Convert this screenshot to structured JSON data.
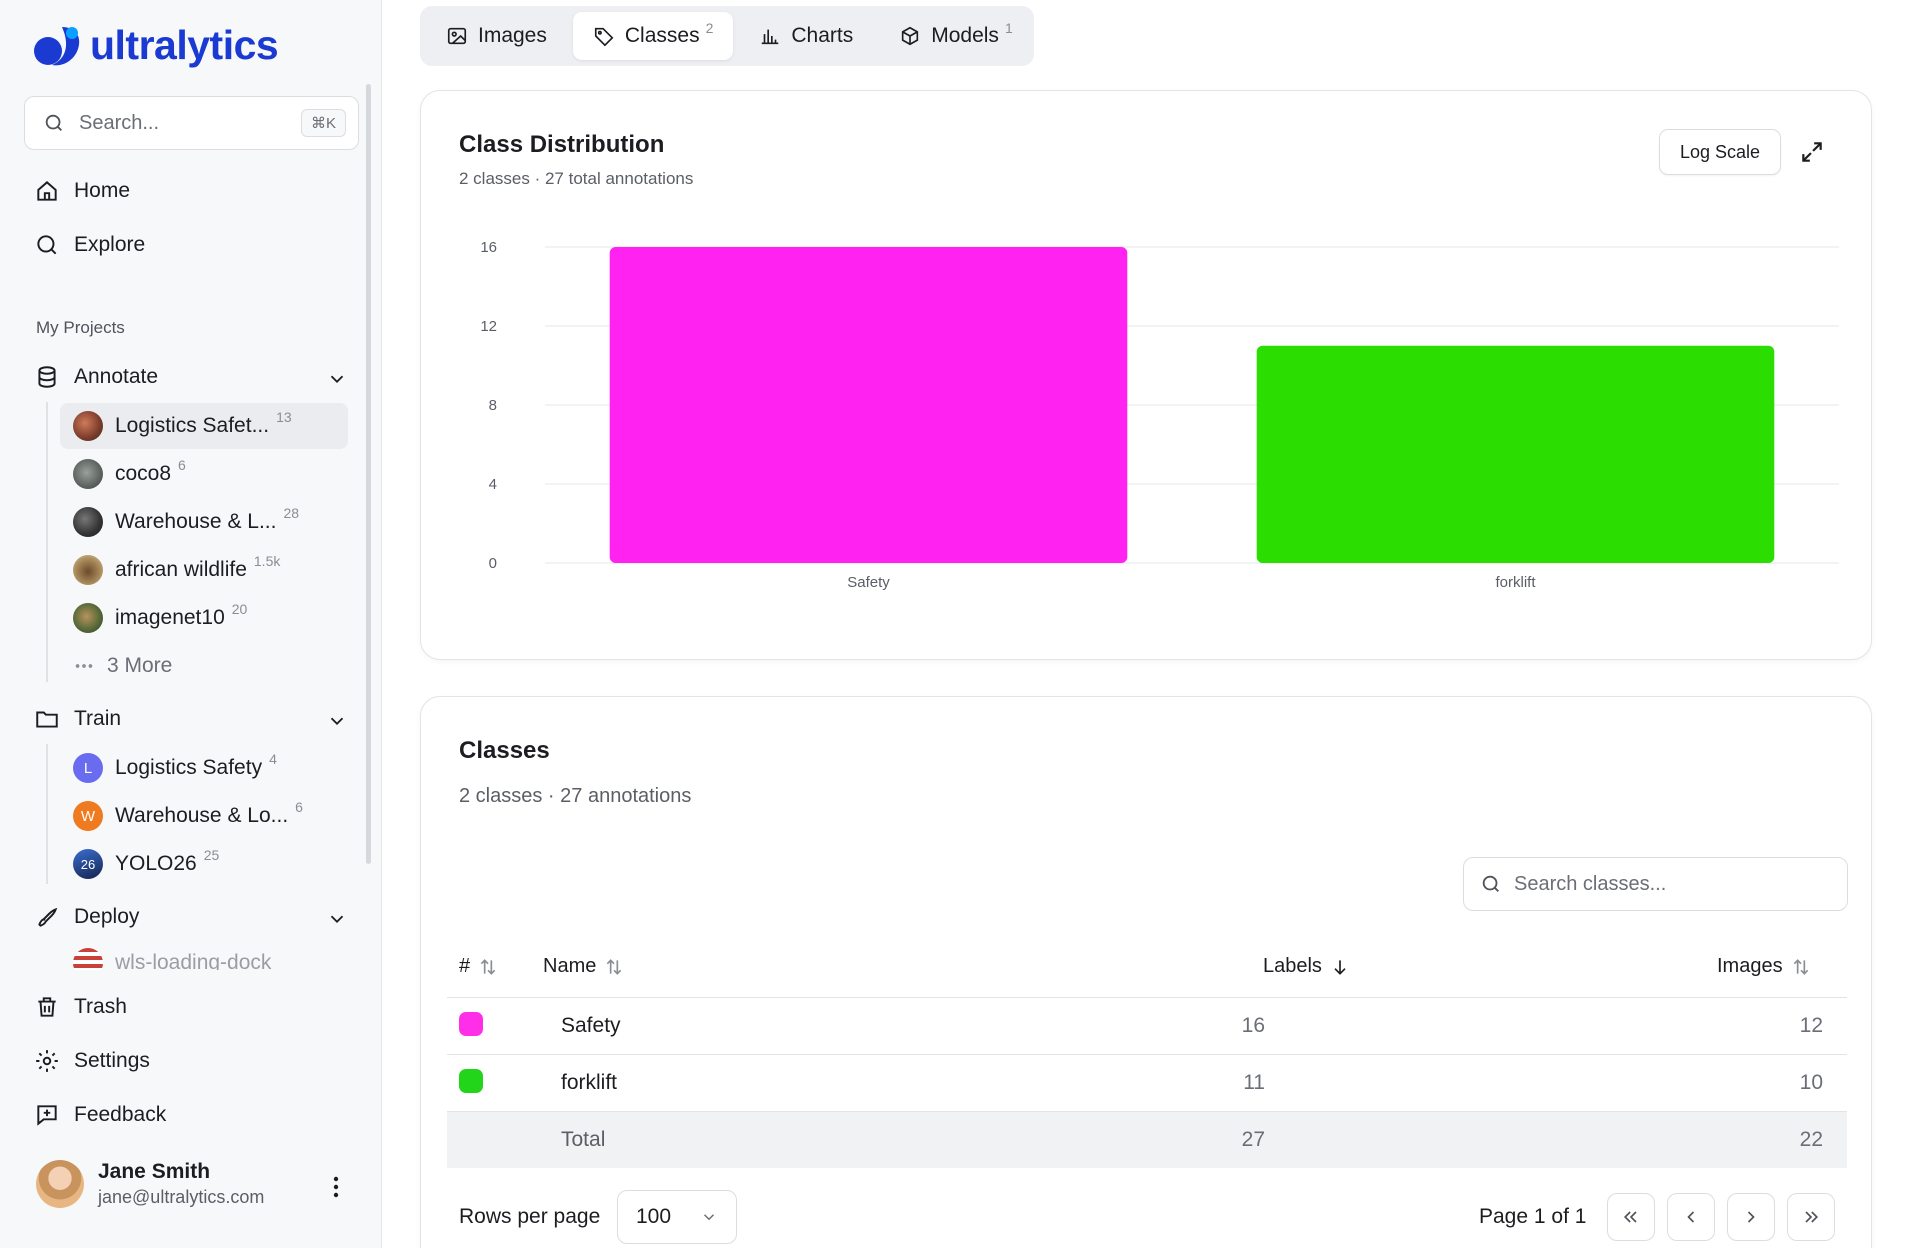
{
  "brand": {
    "name": "ultralytics"
  },
  "sidebar": {
    "search": {
      "placeholder": "Search...",
      "shortcut": "⌘K"
    },
    "nav": [
      {
        "label": "Home",
        "icon": "home-icon"
      },
      {
        "label": "Explore",
        "icon": "search-icon"
      }
    ],
    "section_label": "My Projects",
    "annotate": {
      "label": "Annotate",
      "items": [
        {
          "label": "Logistics Safet...",
          "count": "13"
        },
        {
          "label": "coco8",
          "count": "6"
        },
        {
          "label": "Warehouse & L...",
          "count": "28"
        },
        {
          "label": "african wildlife",
          "count": "1.5k"
        },
        {
          "label": "imagenet10",
          "count": "20"
        }
      ],
      "more": "3 More"
    },
    "train": {
      "label": "Train",
      "items": [
        {
          "label": "Logistics Safety",
          "count": "4",
          "letter": "L",
          "color": "#6a6cf0"
        },
        {
          "label": "Warehouse & Lo...",
          "count": "6",
          "letter": "W",
          "color": "#f07a1f"
        },
        {
          "label": "YOLO26",
          "count": "25",
          "letter": "26",
          "color": "#1f3d7a"
        }
      ]
    },
    "deploy": {
      "label": "Deploy",
      "partial_item": "wls-loading-dock"
    },
    "bottom": [
      {
        "label": "Trash"
      },
      {
        "label": "Settings"
      },
      {
        "label": "Feedback"
      }
    ],
    "user": {
      "name": "Jane Smith",
      "email": "jane@ultralytics.com"
    }
  },
  "tabs": [
    {
      "label": "Images",
      "count": ""
    },
    {
      "label": "Classes",
      "count": "2"
    },
    {
      "label": "Charts",
      "count": ""
    },
    {
      "label": "Models",
      "count": "1"
    }
  ],
  "distribution": {
    "title": "Class Distribution",
    "subtitle": "2 classes · 27 total annotations",
    "log_scale_label": "Log Scale"
  },
  "chart_data": {
    "type": "bar",
    "categories": [
      "Safety",
      "forklift"
    ],
    "values": [
      16,
      11
    ],
    "colors": [
      "#ff22f0",
      "#2bdd00"
    ],
    "yticks": [
      0,
      4,
      8,
      12,
      16
    ],
    "ylim": [
      0,
      16
    ],
    "grid": true
  },
  "classes": {
    "title": "Classes",
    "subtitle": "2 classes · 27 annotations",
    "search_placeholder": "Search classes...",
    "columns": {
      "index": "#",
      "name": "Name",
      "labels": "Labels",
      "images": "Images"
    },
    "rows": [
      {
        "name": "Safety",
        "labels": "16",
        "images": "12",
        "color": "#ff2ee8"
      },
      {
        "name": "forklift",
        "labels": "11",
        "images": "10",
        "color": "#22d41a"
      }
    ],
    "total": {
      "name": "Total",
      "labels": "27",
      "images": "22"
    },
    "rows_per_page_label": "Rows per page",
    "rows_per_page_value": "100",
    "page_label": "Page 1 of 1"
  }
}
